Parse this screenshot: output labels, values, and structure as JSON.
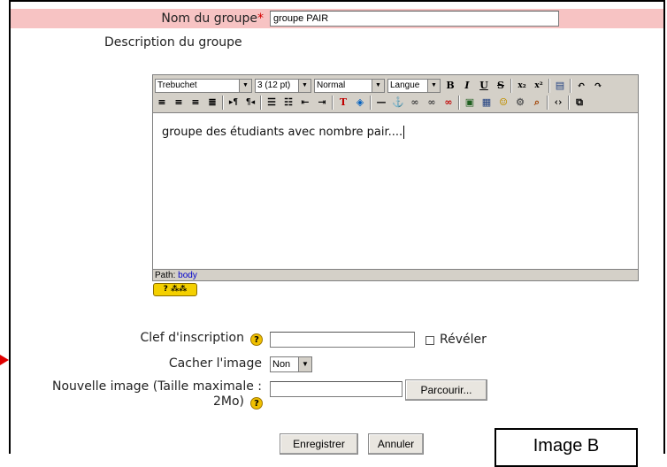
{
  "form": {
    "name_label": "Nom du groupe",
    "name_required": "*",
    "name_value": "groupe PAIR",
    "description_label": "Description du groupe",
    "enrol_label": "Clef d'inscription",
    "enrol_value": "",
    "reveal_label": "Révéler",
    "hide_picture_label": "Cacher l'image",
    "hide_picture_value": "Non",
    "new_image_label_1": "Nouvelle image (Taille maximale :",
    "new_image_label_2": "2Mo)",
    "browse_label": "Parcourir...",
    "save_label": "Enregistrer",
    "cancel_label": "Annuler",
    "help_glyph": "?"
  },
  "editor": {
    "font_value": "Trebuchet",
    "size_value": "3 (12 pt)",
    "format_value": "Normal",
    "lang_value": "Langue",
    "content": "groupe des étudiants avec nombre pair....",
    "path_label": "Path:",
    "path_value": "body"
  },
  "annotation": {
    "image_label": "Image B"
  },
  "colors": {
    "name_row_bg": "#f7c3c3",
    "required": "#d40000",
    "arrow": "#e00000"
  }
}
